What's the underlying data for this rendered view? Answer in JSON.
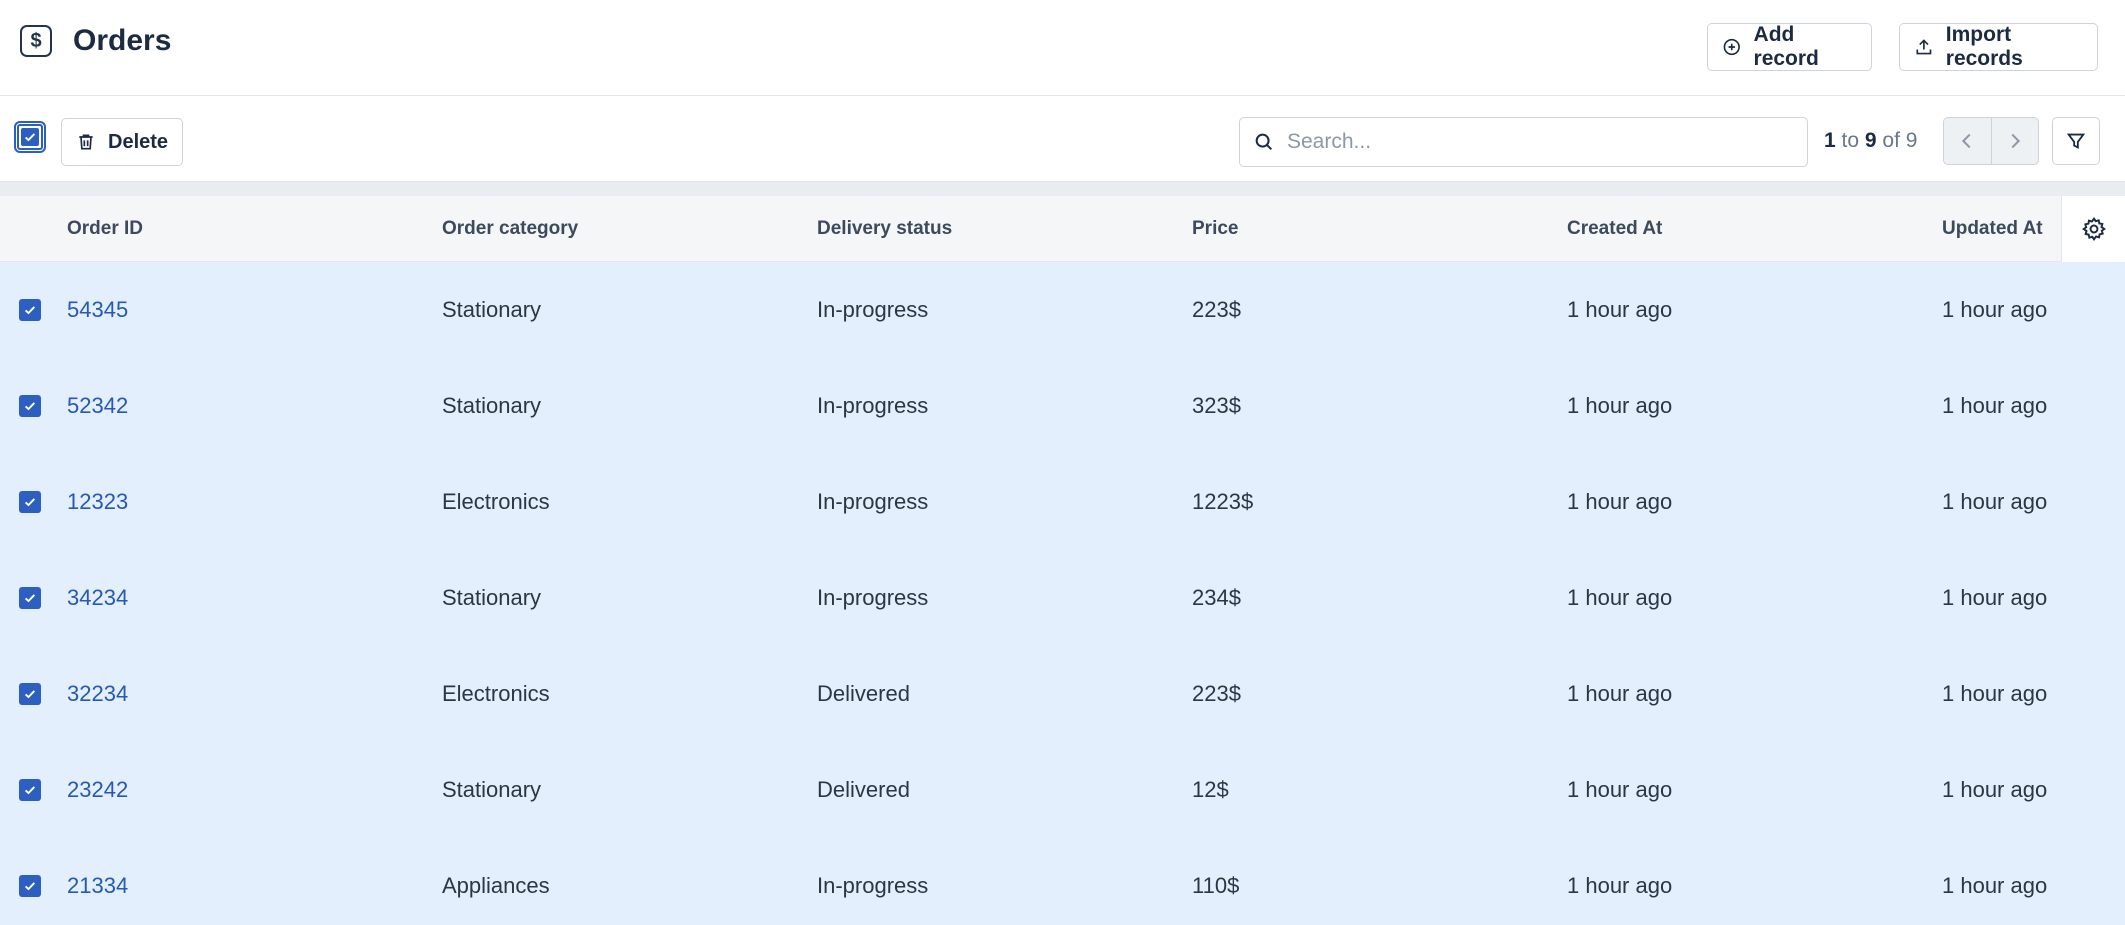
{
  "header": {
    "title": "Orders",
    "logo_icon": "dollar-square-icon",
    "add_record_label": "Add record",
    "import_records_label": "Import records"
  },
  "toolbar": {
    "delete_label": "Delete",
    "search_placeholder": "Search...",
    "search_value": "",
    "pager": {
      "from": "1",
      "to_word": "to",
      "to": "9",
      "of_word": "of",
      "total": "9"
    }
  },
  "table": {
    "columns": [
      "Order ID",
      "Order category",
      "Delivery status",
      "Price",
      "Created At",
      "Updated At"
    ],
    "rows": [
      {
        "id": "54345",
        "category": "Stationary",
        "status": "In-progress",
        "price": "223$",
        "created": "1 hour ago",
        "updated": "1 hour ago",
        "checked": true
      },
      {
        "id": "52342",
        "category": "Stationary",
        "status": "In-progress",
        "price": "323$",
        "created": "1 hour ago",
        "updated": "1 hour ago",
        "checked": true
      },
      {
        "id": "12323",
        "category": "Electronics",
        "status": "In-progress",
        "price": "1223$",
        "created": "1 hour ago",
        "updated": "1 hour ago",
        "checked": true
      },
      {
        "id": "34234",
        "category": "Stationary",
        "status": "In-progress",
        "price": "234$",
        "created": "1 hour ago",
        "updated": "1 hour ago",
        "checked": true
      },
      {
        "id": "32234",
        "category": "Electronics",
        "status": "Delivered",
        "price": "223$",
        "created": "1 hour ago",
        "updated": "1 hour ago",
        "checked": true
      },
      {
        "id": "23242",
        "category": "Stationary",
        "status": "Delivered",
        "price": "12$",
        "created": "1 hour ago",
        "updated": "1 hour ago",
        "checked": true
      },
      {
        "id": "21334",
        "category": "Appliances",
        "status": "In-progress",
        "price": "110$",
        "created": "1 hour ago",
        "updated": "1 hour ago",
        "checked": true
      }
    ]
  },
  "colors": {
    "accent": "#2d5fc0",
    "link": "#2559b3",
    "selected_row_bg": "#e3effc",
    "header_bg": "#f5f6f8"
  }
}
